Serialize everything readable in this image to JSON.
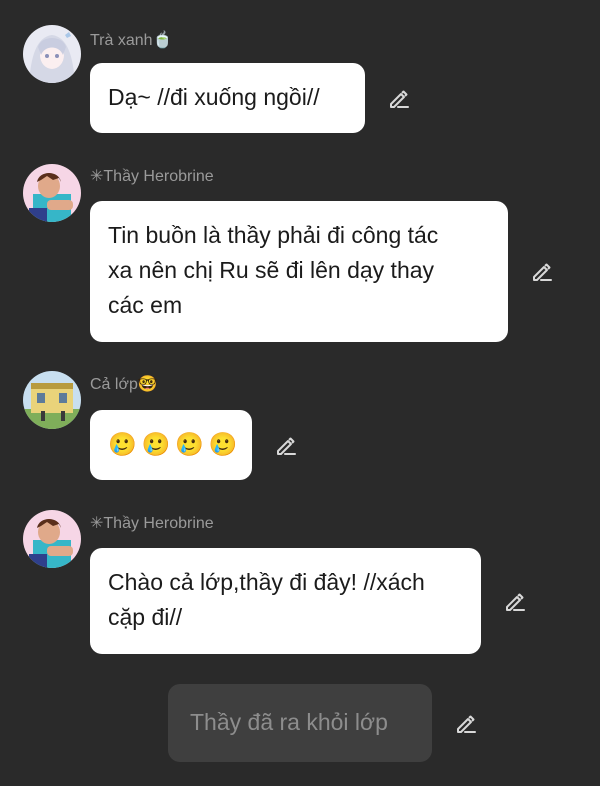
{
  "messages": [
    {
      "sender": "Trà xanh🍵",
      "text": "Dạ~ //đi xuống ngồi//"
    },
    {
      "sender": "✳Thầy Herobrine",
      "lines": [
        "Tin buồn là thầy phải đi công tác",
        "xa nên chị Ru sẽ đi lên dạy thay",
        "các em"
      ]
    },
    {
      "sender": "Cả lớp🤓",
      "emojis": [
        "🥲",
        "🥲",
        "🥲",
        "🥲"
      ]
    },
    {
      "sender": "✳Thầy Herobrine",
      "lines": [
        "Chào cả lớp,thầy đi đây! //xách",
        "cặp đi//"
      ]
    }
  ],
  "narration": "Thầy đã ra khỏi lớp",
  "icons": {
    "edit": "pencil-edit-icon"
  },
  "colors": {
    "background": "#2a2a2a",
    "bubble": "#ffffff",
    "narration_bubble": "#3f3f3f",
    "name": "#9a9a9a"
  }
}
